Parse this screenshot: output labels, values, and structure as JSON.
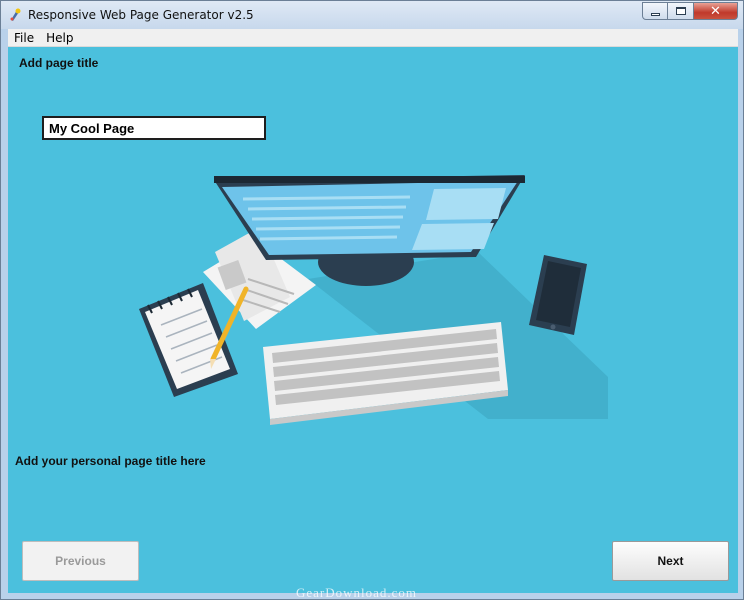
{
  "window": {
    "title": "Responsive Web Page Generator v2.5",
    "controls": {
      "minimize_icon": "minimize-icon",
      "maximize_icon": "maximize-icon",
      "close_icon": "close-icon",
      "close_glyph": "✕"
    }
  },
  "menu": {
    "items": [
      "File",
      "Help"
    ]
  },
  "main": {
    "heading": "Add page title",
    "title_input_value": "My Cool Page",
    "illustration_icon": "desk-workspace-illustration",
    "hint": "Add your personal page title here"
  },
  "footer": {
    "previous_label": "Previous",
    "previous_enabled": false,
    "next_label": "Next"
  },
  "watermark": "GearDownload.com",
  "colors": {
    "background": "#4bc0dd",
    "monitor": "#2b3e50",
    "screen": "#5dade2",
    "keyboard": "#e6e6e6"
  }
}
